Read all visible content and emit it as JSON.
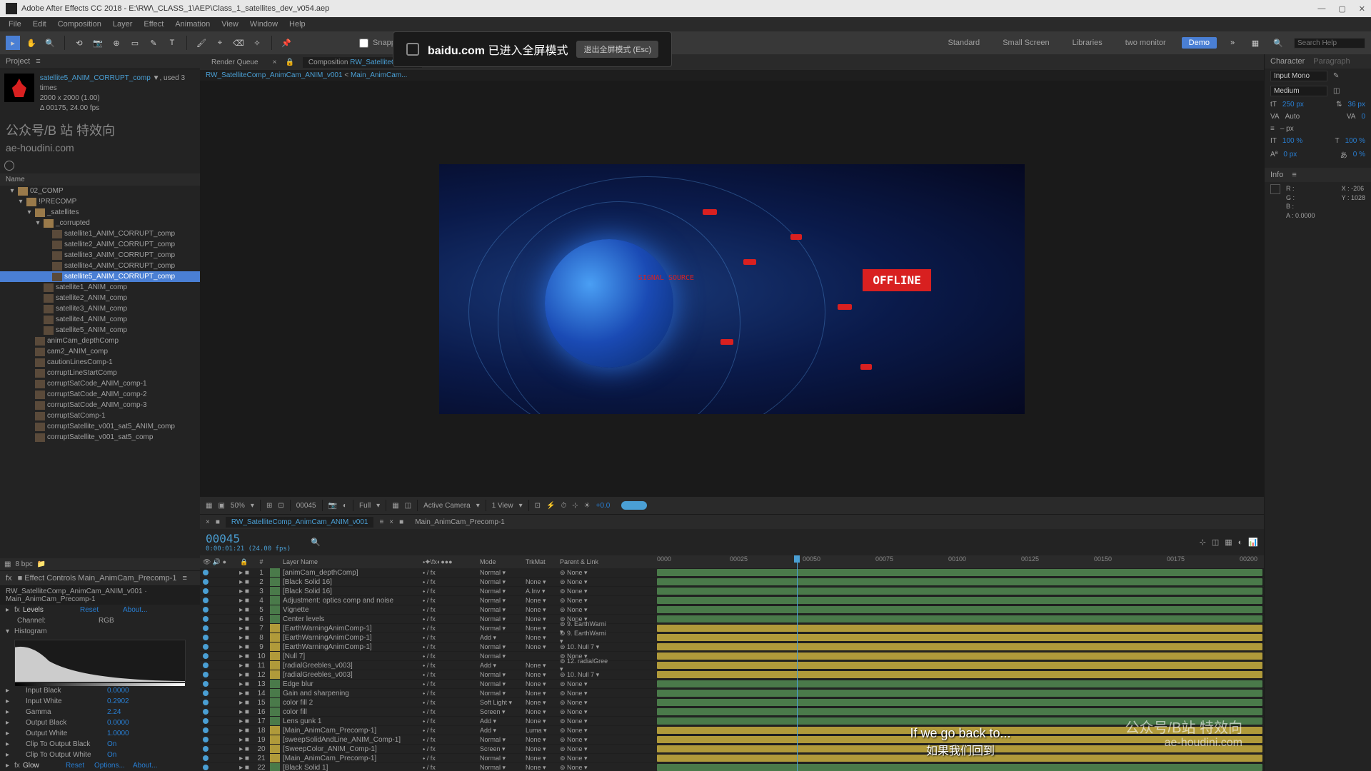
{
  "app": {
    "title": "Adobe After Effects CC 2018 - E:\\RW\\_CLASS_1\\AEP\\Class_1_satellites_dev_v054.aep"
  },
  "menu": [
    "File",
    "Edit",
    "Composition",
    "Layer",
    "Effect",
    "Animation",
    "View",
    "Window",
    "Help"
  ],
  "toolbar": {
    "snapping": "Snapping"
  },
  "workspace": [
    "Standard",
    "Small Screen",
    "Libraries",
    "two monitor",
    "Demo"
  ],
  "search": {
    "placeholder": "Search Help"
  },
  "project": {
    "tab": "Project",
    "selected_name": "satellite5_ANIM_CORRUPT_comp",
    "used": ", used 3 times",
    "dims": "2000 x 2000 (1.00)",
    "dur": "Δ 00175, 24.00 fps",
    "watermark_cn": "公众号/B 站 特效向",
    "watermark_url": "ae-houdini.com",
    "name_header": "Name",
    "tree": [
      {
        "pad": 12,
        "t": "folder",
        "open": true,
        "label": "02_COMP"
      },
      {
        "pad": 24,
        "t": "folder",
        "open": true,
        "label": "!PRECOMP"
      },
      {
        "pad": 36,
        "t": "folder",
        "open": true,
        "label": "_satellites"
      },
      {
        "pad": 48,
        "t": "folder",
        "open": true,
        "label": "_corrupted"
      },
      {
        "pad": 60,
        "t": "comp",
        "label": "satellite1_ANIM_CORRUPT_comp"
      },
      {
        "pad": 60,
        "t": "comp",
        "label": "satellite2_ANIM_CORRUPT_comp"
      },
      {
        "pad": 60,
        "t": "comp",
        "label": "satellite3_ANIM_CORRUPT_comp"
      },
      {
        "pad": 60,
        "t": "comp",
        "label": "satellite4_ANIM_CORRUPT_comp"
      },
      {
        "pad": 60,
        "t": "comp",
        "label": "satellite5_ANIM_CORRUPT_comp",
        "selected": true
      },
      {
        "pad": 48,
        "t": "comp",
        "label": "satellite1_ANIM_comp"
      },
      {
        "pad": 48,
        "t": "comp",
        "label": "satellite2_ANIM_comp"
      },
      {
        "pad": 48,
        "t": "comp",
        "label": "satellite3_ANIM_comp"
      },
      {
        "pad": 48,
        "t": "comp",
        "label": "satellite4_ANIM_comp"
      },
      {
        "pad": 48,
        "t": "comp",
        "label": "satellite5_ANIM_comp"
      },
      {
        "pad": 36,
        "t": "comp",
        "label": "animCam_depthComp"
      },
      {
        "pad": 36,
        "t": "comp",
        "label": "cam2_ANIM_comp"
      },
      {
        "pad": 36,
        "t": "comp",
        "label": "cautionLinesComp-1"
      },
      {
        "pad": 36,
        "t": "comp",
        "label": "corruptLineStartComp"
      },
      {
        "pad": 36,
        "t": "comp",
        "label": "corruptSatCode_ANIM_comp-1"
      },
      {
        "pad": 36,
        "t": "comp",
        "label": "corruptSatCode_ANIM_comp-2"
      },
      {
        "pad": 36,
        "t": "comp",
        "label": "corruptSatCode_ANIM_comp-3"
      },
      {
        "pad": 36,
        "t": "comp",
        "label": "corruptSatComp-1"
      },
      {
        "pad": 36,
        "t": "comp",
        "label": "corruptSatellite_v001_sat5_ANIM_comp"
      },
      {
        "pad": 36,
        "t": "comp",
        "label": "corruptSatellite_v001_sat5_comp"
      }
    ],
    "footer": "8 bpc"
  },
  "effects": {
    "tab": "Effect Controls",
    "comp_link": "Main_AnimCam_Precomp-1",
    "path": "RW_SatelliteComp_AnimCam_ANIM_v001 · Main_AnimCam_Precomp-1",
    "levels": {
      "name": "Levels",
      "reset": "Reset",
      "about": "About..."
    },
    "channel": {
      "label": "Channel:",
      "value": "RGB"
    },
    "histogram": "Histogram",
    "props": [
      {
        "name": "Input Black",
        "val": "0.0000"
      },
      {
        "name": "Input White",
        "val": "0.2902"
      },
      {
        "name": "Gamma",
        "val": "2.24"
      },
      {
        "name": "Output Black",
        "val": "0.0000"
      },
      {
        "name": "Output White",
        "val": "1.0000"
      },
      {
        "name": "Clip To Output Black",
        "val": "On"
      },
      {
        "name": "Clip To Output White",
        "val": "On"
      }
    ],
    "glow": {
      "name": "Glow",
      "reset": "Reset",
      "options": "Options...",
      "about": "About..."
    }
  },
  "comp": {
    "render_queue": "Render Queue",
    "tab_prefix": "Composition",
    "tab_name": "RW_SatelliteComp...",
    "breadcrumb": [
      "RW_SatelliteComp_AnimCam_ANIM_v001",
      "Main_AnimCam..."
    ]
  },
  "viewport": {
    "offline": "OFFLINE",
    "signal": "SIGNAL SOURCE",
    "zoom": "50%",
    "frame": "00045",
    "res": "Full",
    "camera": "Active Camera",
    "view": "1 View",
    "exposure": "+0.0"
  },
  "timeline": {
    "tab1": "RW_SatelliteComp_AnimCam_ANIM_v001",
    "tab2": "Main_AnimCam_Precomp-1",
    "timecode": "00045",
    "timecode_sub": "0:00:01:21 (24.00 fps)",
    "cols": {
      "layername": "Layer Name",
      "mode": "Mode",
      "trkmat": "TrkMat",
      "parent": "Parent & Link"
    },
    "ticks": [
      "0000",
      "00025",
      "00050",
      "00075",
      "00100",
      "00125",
      "00150",
      "00175",
      "00200"
    ],
    "layers": [
      {
        "n": 1,
        "c": "#4a7a4a",
        "name": "[animCam_depthComp]",
        "mode": "Normal",
        "trk": "",
        "par": "None",
        "bar": "#4a7a4a"
      },
      {
        "n": 2,
        "c": "#4a7a4a",
        "name": "[Black Solid 16]",
        "mode": "Normal",
        "trk": "None",
        "par": "None",
        "bar": "#4a7a4a"
      },
      {
        "n": 3,
        "c": "#4a7a4a",
        "name": "[Black Solid 16]",
        "mode": "Normal",
        "trk": "A.Inv",
        "par": "None",
        "bar": "#4a7a4a"
      },
      {
        "n": 4,
        "c": "#4a7a4a",
        "name": "Adjustment: optics comp and noise",
        "mode": "Normal",
        "trk": "None",
        "par": "None",
        "bar": "#4a7a4a"
      },
      {
        "n": 5,
        "c": "#4a7a4a",
        "name": "Vignette",
        "mode": "Normal",
        "trk": "None",
        "par": "None",
        "bar": "#4a7a4a"
      },
      {
        "n": 6,
        "c": "#4a7a4a",
        "name": "Center levels",
        "mode": "Normal",
        "trk": "None",
        "par": "None",
        "bar": "#4a7a4a"
      },
      {
        "n": 7,
        "c": "#b09a3a",
        "name": "[EarthWarningAnimComp-1]",
        "mode": "Normal",
        "trk": "None",
        "par": "9. EarthWarni",
        "bar": "#b09a3a"
      },
      {
        "n": 8,
        "c": "#b09a3a",
        "name": "[EarthWarningAnimComp-1]",
        "mode": "Add",
        "trk": "None",
        "par": "9. EarthWarni",
        "bar": "#b09a3a"
      },
      {
        "n": 9,
        "c": "#b09a3a",
        "name": "[EarthWarningAnimComp-1]",
        "mode": "Normal",
        "trk": "None",
        "par": "10. Null 7",
        "bar": "#b09a3a"
      },
      {
        "n": 10,
        "c": "#b09a3a",
        "name": "[Null 7]",
        "mode": "Normal",
        "trk": "",
        "par": "None",
        "bar": "#b09a3a"
      },
      {
        "n": 11,
        "c": "#b09a3a",
        "name": "[radialGreebles_v003]",
        "mode": "Add",
        "trk": "None",
        "par": "12. radialGree",
        "bar": "#b09a3a"
      },
      {
        "n": 12,
        "c": "#b09a3a",
        "name": "[radialGreebles_v003]",
        "mode": "Normal",
        "trk": "None",
        "par": "10. Null 7",
        "bar": "#b09a3a"
      },
      {
        "n": 13,
        "c": "#4a7a4a",
        "name": "Edge blur",
        "mode": "Normal",
        "trk": "None",
        "par": "None",
        "bar": "#4a7a4a"
      },
      {
        "n": 14,
        "c": "#4a7a4a",
        "name": "Gain and sharpening",
        "mode": "Normal",
        "trk": "None",
        "par": "None",
        "bar": "#4a7a4a"
      },
      {
        "n": 15,
        "c": "#4a7a4a",
        "name": "color fill 2",
        "mode": "Soft Light",
        "trk": "None",
        "par": "None",
        "bar": "#4a7a4a"
      },
      {
        "n": 16,
        "c": "#4a7a4a",
        "name": "color fill",
        "mode": "Screen",
        "trk": "None",
        "par": "None",
        "bar": "#4a7a4a"
      },
      {
        "n": 17,
        "c": "#4a7a4a",
        "name": "Lens gunk 1",
        "mode": "Add",
        "trk": "None",
        "par": "None",
        "bar": "#4a7a4a"
      },
      {
        "n": 18,
        "c": "#b09a3a",
        "name": "[Main_AnimCam_Precomp-1]",
        "mode": "Add",
        "trk": "Luma",
        "par": "None",
        "bar": "#b09a3a"
      },
      {
        "n": 19,
        "c": "#b09a3a",
        "name": "[sweepSolidAndLine_ANIM_Comp-1]",
        "mode": "Normal",
        "trk": "None",
        "par": "None",
        "bar": "#b09a3a"
      },
      {
        "n": 20,
        "c": "#b09a3a",
        "name": "[SweepColor_ANIM_Comp-1]",
        "mode": "Screen",
        "trk": "None",
        "par": "None",
        "bar": "#b09a3a"
      },
      {
        "n": 21,
        "c": "#b09a3a",
        "name": "[Main_AnimCam_Precomp-1]",
        "mode": "Normal",
        "trk": "None",
        "par": "None",
        "bar": "#b09a3a"
      },
      {
        "n": 22,
        "c": "#4a7a4a",
        "name": "[Black Solid 1]",
        "mode": "Normal",
        "trk": "None",
        "par": "None",
        "bar": "#4a7a4a"
      }
    ]
  },
  "character": {
    "tab1": "Character",
    "tab2": "Paragraph",
    "font": "Input Mono",
    "style": "Medium",
    "size": "250 px",
    "leading": "36 px",
    "kerning": "Auto",
    "tracking": "– px",
    "vscale": "100 %",
    "hscale": "100 %",
    "baseline": "0 px",
    "tsume": "0 %"
  },
  "info": {
    "tab": "Info",
    "r": "R :",
    "g": "G :",
    "b": "B :",
    "a": "A :",
    "x": "X : -206",
    "y": "Y : 1028",
    "aval": "0.0000"
  },
  "overlay": {
    "domain": "baidu.com",
    "msg": "已进入全屏模式",
    "exit": "退出全屏模式 (Esc)"
  },
  "subtitle": {
    "en": "If we go back to...",
    "cn": "如果我们回到"
  },
  "wm": {
    "l1": "公众号/B站 特效向",
    "l2": "ae-houdini.com"
  }
}
